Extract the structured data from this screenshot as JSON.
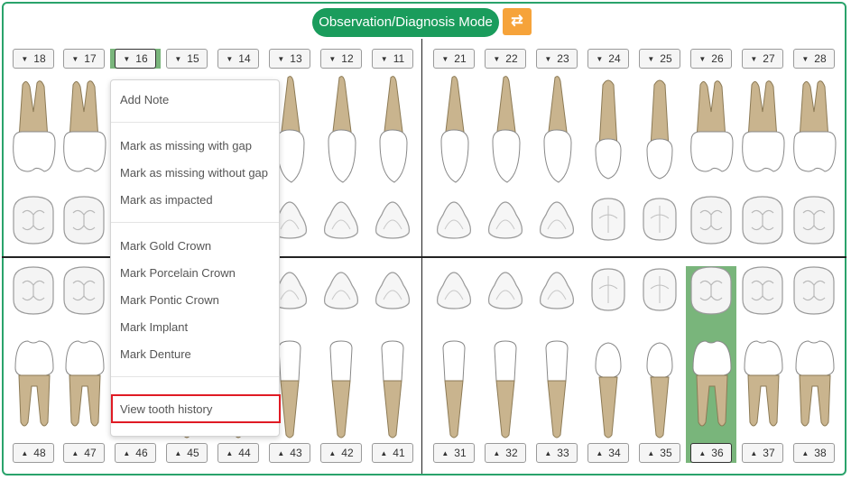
{
  "mode": {
    "label": "Observation/Diagnosis Mode",
    "swap_icon": "⇄",
    "swap_icon_name": "swap-arrows-icon"
  },
  "colors": {
    "accent": "#1a9c5c",
    "swap": "#f6a33a",
    "selected": "#79b57b",
    "highlight": "#e01b24"
  },
  "upper_right": [
    "18",
    "17",
    "16",
    "15",
    "14",
    "13",
    "12",
    "11"
  ],
  "upper_left": [
    "21",
    "22",
    "23",
    "24",
    "25",
    "26",
    "27",
    "28"
  ],
  "lower_right": [
    "48",
    "47",
    "46",
    "45",
    "44",
    "43",
    "42",
    "41"
  ],
  "lower_left": [
    "31",
    "32",
    "33",
    "34",
    "35",
    "36",
    "37",
    "38"
  ],
  "selected_teeth": [
    "16",
    "36"
  ],
  "menu": {
    "add_note": "Add Note",
    "missing_gap": "Mark as missing with gap",
    "missing_no_gap": "Mark as missing without gap",
    "impacted": "Mark as impacted",
    "gold_crown": "Mark Gold Crown",
    "porcelain_crown": "Mark Porcelain Crown",
    "pontic_crown": "Mark Pontic Crown",
    "implant": "Mark Implant",
    "denture": "Mark Denture",
    "history": "View tooth history"
  }
}
